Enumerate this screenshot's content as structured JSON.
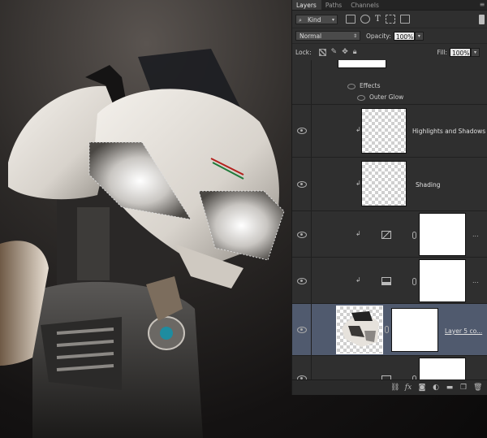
{
  "panel": {
    "tabs": [
      {
        "label": "Layers",
        "active": true
      },
      {
        "label": "Paths",
        "active": false
      },
      {
        "label": "Channels",
        "active": false
      }
    ],
    "filter": {
      "kind_label": "Kind"
    },
    "blend_mode": "Normal",
    "opacity_label": "Opacity:",
    "opacity_value": "100%",
    "lock_label": "Lock:",
    "fill_label": "Fill:",
    "fill_value": "100%"
  },
  "layers": {
    "effects_label": "Effects",
    "outer_glow_label": "Outer Glow",
    "highlights_name": "Highlights and Shadows",
    "shading_name": "Shading",
    "selected_name": "Layer 5 co...",
    "more_glyph": "..."
  },
  "colors": {
    "panel_bg": "#2f2f2f",
    "selected_layer": "#505a6e",
    "canvas_bg": "#1a1818"
  },
  "icons": [
    "search-icon",
    "image-filter-icon",
    "adjustment-filter-icon",
    "type-filter-icon",
    "shape-filter-icon",
    "smart-object-filter-icon",
    "eye-icon",
    "chain-link-icon",
    "curves-adjustment-icon",
    "levels-adjustment-icon",
    "link-layers-icon",
    "fx-icon",
    "mask-icon",
    "new-adjustment-icon",
    "folder-icon",
    "new-layer-icon",
    "trash-icon"
  ]
}
